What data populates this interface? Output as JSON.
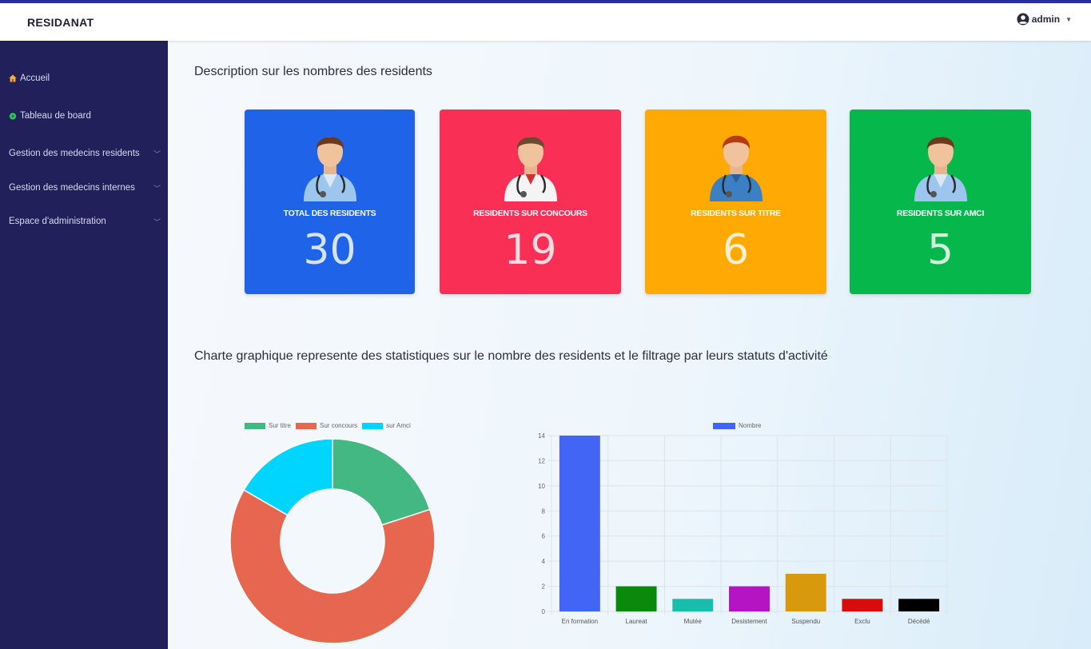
{
  "app": {
    "brand": "RESIDANAT",
    "user": "admin"
  },
  "icons": {
    "user": "user-circle-icon",
    "caret": "caret-down-icon",
    "home": "home-icon",
    "dashboard": "dashboard-icon",
    "chevron": "chevron-down-icon",
    "doctor": "doctor-icon"
  },
  "sidebar": {
    "items": [
      {
        "label": "Accueil"
      },
      {
        "label": "Tableau de board"
      },
      {
        "label": "Gestion des medecins residents"
      },
      {
        "label": "Gestion des medecins internes"
      },
      {
        "label": "Espace d'administration"
      }
    ]
  },
  "main": {
    "section1_title": "Description sur les nombres des residents",
    "section2_title": "Charte graphique represente des statistiques sur le nombre des residents et le filtrage par leurs statuts d'activité"
  },
  "cards": [
    {
      "label": "TOTAL DES RESIDENTS",
      "value": "30",
      "color": "#1f63e8"
    },
    {
      "label": "RESIDENTS SUR CONCOURS",
      "value": "19",
      "color": "#fa2f56"
    },
    {
      "label": "RESIDENTS SUR TITRE",
      "value": "6",
      "color": "#ffaa04"
    },
    {
      "label": "RESIDENTS SUR AMCI",
      "value": "5",
      "color": "#06b84c"
    }
  ],
  "chart_data": [
    {
      "type": "pie",
      "donut": true,
      "legend_position": "top",
      "labels": [
        "Sur titre",
        "Sur concours",
        "sur Amci"
      ],
      "values": [
        6,
        19,
        5
      ],
      "colors": [
        "#43b883",
        "#e76650",
        "#00d5ff"
      ]
    },
    {
      "type": "bar",
      "legend_position": "top",
      "categories": [
        "En formation",
        "Laureat",
        "Mutée",
        "Desistement",
        "Suspendu",
        "Exclu",
        "Décédé"
      ],
      "series": [
        {
          "name": "Nombre",
          "values": [
            14,
            2,
            1,
            2,
            3,
            1,
            1
          ]
        }
      ],
      "colors": [
        "#4365f5",
        "#0a8a0a",
        "#19bdae",
        "#b414c4",
        "#d9990c",
        "#d80c0c",
        "#000000"
      ],
      "legend_color": "#4365f5",
      "ylim": [
        0,
        14
      ],
      "yticks": [
        0,
        2,
        4,
        6,
        8,
        10,
        12,
        14
      ],
      "grid": true
    }
  ]
}
